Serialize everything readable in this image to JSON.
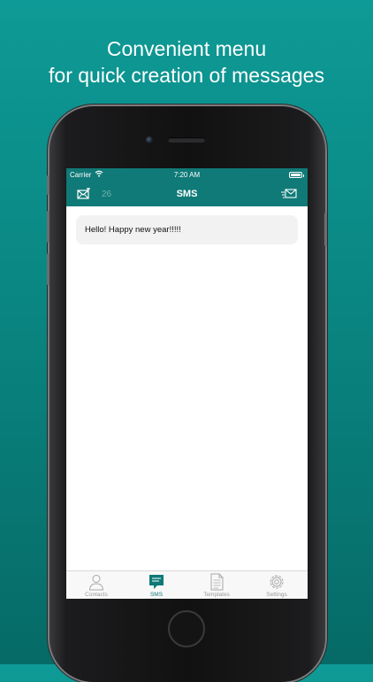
{
  "headline": {
    "line1": "Convenient menu",
    "line2": "for quick creation of messages"
  },
  "status_bar": {
    "carrier": "Carrier",
    "time": "7:20 AM"
  },
  "nav": {
    "count": "26",
    "title": "SMS",
    "left_icon": "compose-message-icon",
    "right_icon": "send-message-icon"
  },
  "messages": [
    {
      "text": "Hello! Happy new year!!!!!"
    }
  ],
  "tabs": [
    {
      "label": "Contacts",
      "icon": "contacts-icon",
      "active": false
    },
    {
      "label": "SMS",
      "icon": "sms-icon",
      "active": true
    },
    {
      "label": "Templates",
      "icon": "templates-icon",
      "active": false
    },
    {
      "label": "Settings",
      "icon": "settings-icon",
      "active": false
    }
  ],
  "colors": {
    "accent": "#0f7a77",
    "background_top": "#0e9a96",
    "background_bottom": "#066a66"
  }
}
